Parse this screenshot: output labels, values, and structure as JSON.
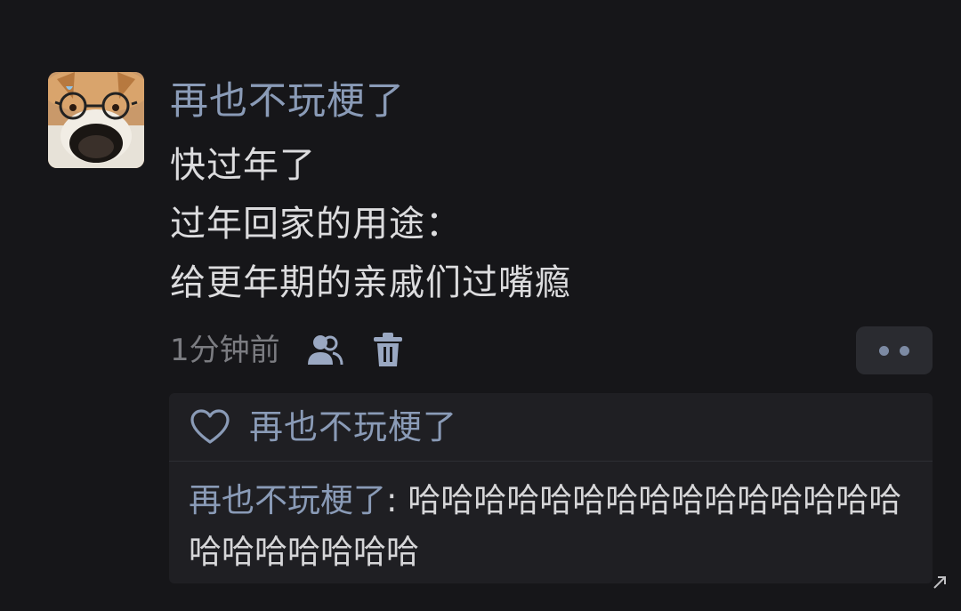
{
  "post": {
    "author": "再也不玩梗了",
    "avatar_icon": "shiba-dog-with-glasses-avatar",
    "lines": [
      "快过年了",
      "过年回家的用途：",
      "给更年期的亲戚们过嘴瘾"
    ],
    "time": "1分钟前",
    "actions": {
      "visibility_icon": "people-icon",
      "delete_icon": "trash-icon",
      "more_icon": "more-dots-icon"
    }
  },
  "likes": {
    "icon": "heart-icon",
    "user": "再也不玩梗了"
  },
  "reply": {
    "author": "再也不玩梗了",
    "separator": ": ",
    "text": "哈哈哈哈哈哈哈哈哈哈哈哈哈哈哈哈哈哈哈哈哈哈"
  },
  "colors": {
    "background": "#161619",
    "name_blue": "#8a9bb7",
    "text": "#dcdcde",
    "muted": "#7b7c81",
    "reply_bg": "#1f1f23"
  }
}
